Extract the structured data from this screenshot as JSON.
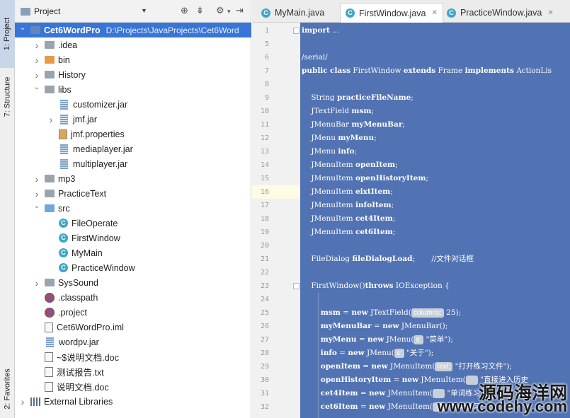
{
  "left_strip": {
    "project_tab": "1: Project",
    "structure_tab": "7: Structure",
    "favorites_tab": "2: Favorites"
  },
  "project_panel": {
    "title": "Project",
    "dropdown_icon": "caret-down-icon",
    "header_icons": [
      "crosshair-icon",
      "collapse-all-icon",
      "gear-icon",
      "hide-icon"
    ]
  },
  "tree": [
    {
      "depth": 0,
      "arrow": "down",
      "icon": "project-folder",
      "label": "Cet6WordPro",
      "path": "D:\\Projects\\JavaProjects\\Cet6Word",
      "selected": true
    },
    {
      "depth": 1,
      "arrow": "right",
      "icon": "folder",
      "label": ".idea"
    },
    {
      "depth": 1,
      "arrow": "right",
      "icon": "folder-orange",
      "label": "bin"
    },
    {
      "depth": 1,
      "arrow": "right",
      "icon": "folder",
      "label": "History"
    },
    {
      "depth": 1,
      "arrow": "down",
      "icon": "folder",
      "label": "libs"
    },
    {
      "depth": 2,
      "arrow": "",
      "icon": "jar",
      "label": "customizer.jar"
    },
    {
      "depth": 2,
      "arrow": "right",
      "icon": "jar",
      "label": "jmf.jar"
    },
    {
      "depth": 2,
      "arrow": "",
      "icon": "properties",
      "label": "jmf.properties"
    },
    {
      "depth": 2,
      "arrow": "",
      "icon": "jar",
      "label": "mediaplayer.jar"
    },
    {
      "depth": 2,
      "arrow": "",
      "icon": "jar",
      "label": "multiplayer.jar"
    },
    {
      "depth": 1,
      "arrow": "right",
      "icon": "folder",
      "label": "mp3"
    },
    {
      "depth": 1,
      "arrow": "right",
      "icon": "folder",
      "label": "PracticeText"
    },
    {
      "depth": 1,
      "arrow": "down",
      "icon": "folder-blue",
      "label": "src"
    },
    {
      "depth": 2,
      "arrow": "",
      "icon": "class",
      "label": "FileOperate"
    },
    {
      "depth": 2,
      "arrow": "",
      "icon": "class",
      "label": "FirstWindow"
    },
    {
      "depth": 2,
      "arrow": "",
      "icon": "class",
      "label": "MyMain"
    },
    {
      "depth": 2,
      "arrow": "",
      "icon": "class",
      "label": "PracticeWindow"
    },
    {
      "depth": 1,
      "arrow": "right",
      "icon": "folder",
      "label": "SysSound"
    },
    {
      "depth": 1,
      "arrow": "",
      "icon": "classpath",
      "label": ".classpath"
    },
    {
      "depth": 1,
      "arrow": "",
      "icon": "classpath",
      "label": ".project"
    },
    {
      "depth": 1,
      "arrow": "",
      "icon": "doc",
      "label": "Cet6WordPro.iml"
    },
    {
      "depth": 1,
      "arrow": "",
      "icon": "jar",
      "label": "wordpv.jar"
    },
    {
      "depth": 1,
      "arrow": "",
      "icon": "doc",
      "label": "~$说明文档.doc"
    },
    {
      "depth": 1,
      "arrow": "",
      "icon": "doc",
      "label": "测试报告.txt"
    },
    {
      "depth": 1,
      "arrow": "",
      "icon": "doc",
      "label": "说明文档.doc"
    },
    {
      "depth": 0,
      "arrow": "right",
      "icon": "libraries",
      "label": "External Libraries"
    }
  ],
  "tabs": [
    {
      "label": "MyMain.java",
      "active": false
    },
    {
      "label": "FirstWindow.java",
      "active": true
    },
    {
      "label": "PracticeWindow.java",
      "active": false
    }
  ],
  "editor": {
    "current_line": 16,
    "lines": [
      {
        "n": "1",
        "text": "import ..."
      },
      {
        "n": "5",
        "text": ""
      },
      {
        "n": "6",
        "text": "/serial/"
      },
      {
        "n": "7",
        "text": "public class FirstWindow extends Frame implements ActionLis"
      },
      {
        "n": "8",
        "text": ""
      },
      {
        "n": "9",
        "text": "    String practiceFileName;"
      },
      {
        "n": "10",
        "text": "    JTextField msm;"
      },
      {
        "n": "11",
        "text": "    JMenuBar myMenuBar;"
      },
      {
        "n": "12",
        "text": "    JMenu myMenu;"
      },
      {
        "n": "13",
        "text": "    JMenu info;"
      },
      {
        "n": "14",
        "text": "    JMenuItem openItem;"
      },
      {
        "n": "15",
        "text": "    JMenuItem openHistoryItem;"
      },
      {
        "n": "16",
        "text": "    JMenuItem eixtItem;"
      },
      {
        "n": "17",
        "text": "    JMenuItem infoItem;"
      },
      {
        "n": "18",
        "text": "    JMenuItem cet4Item;"
      },
      {
        "n": "19",
        "text": "    JMenuItem cet6Item;"
      },
      {
        "n": "20",
        "text": ""
      },
      {
        "n": "21",
        "text": "    FileDialog fileDialogLoad;       //文件对话框"
      },
      {
        "n": "22",
        "text": ""
      },
      {
        "n": "23",
        "text": "    FirstWindow()throws IOException {"
      },
      {
        "n": "24",
        "text": ""
      },
      {
        "n": "25",
        "text": "        msm = new JTextField("
      },
      {
        "n": "26",
        "text": "        myMenuBar = new JMenuBar();"
      },
      {
        "n": "27",
        "text": "        myMenu = new JMenu("
      },
      {
        "n": "28",
        "text": "        info = new JMenu("
      },
      {
        "n": "29",
        "text": "        openItem = new JMenuItem("
      },
      {
        "n": "30",
        "text": "        openHistoryItem = new JMenuItem("
      },
      {
        "n": "31",
        "text": "        cet4Item = new JMenuItem("
      },
      {
        "n": "32",
        "text": "        cet6Item = new JMenuItem("
      }
    ],
    "hints": {
      "l25_param": "columns:",
      "l25_rest": "25);",
      "l27_param": "s:",
      "l27_rest": "\"菜单\");",
      "l28_param": "s:",
      "l28_rest": "\"关于\");",
      "l29_param": "text:",
      "l29_rest": "\"打开练习文件\");",
      "l30_rest": "\"直接进入历史",
      "l31_rest": "\"单词练习",
      "l32_rest": "\"单词练习"
    }
  },
  "watermark": {
    "cn": "源码海洋网",
    "url": "www.codehy.com"
  }
}
